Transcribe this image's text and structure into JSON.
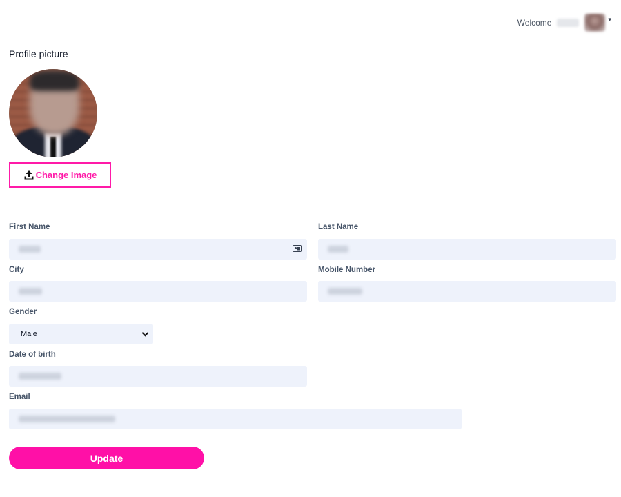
{
  "header": {
    "welcome_label": "Welcome"
  },
  "profile": {
    "section_title": "Profile picture",
    "change_image_label": "Change Image"
  },
  "form": {
    "first_name": {
      "label": "First Name",
      "value": ""
    },
    "last_name": {
      "label": "Last Name",
      "value": ""
    },
    "city": {
      "label": "City",
      "value": ""
    },
    "mobile_number": {
      "label": "Mobile Number",
      "value": ""
    },
    "gender": {
      "label": "Gender",
      "selected": "Male"
    },
    "date_of_birth": {
      "label": "Date of birth",
      "value": ""
    },
    "email": {
      "label": "Email",
      "value": ""
    },
    "submit_label": "Update"
  },
  "colors": {
    "accent": "#ff10a7",
    "input_bg": "#eef2fb",
    "label": "#475569"
  },
  "icons": {
    "upload": "upload-icon",
    "contact_card": "contact-card-icon",
    "chevron": "chevron-down-icon"
  }
}
